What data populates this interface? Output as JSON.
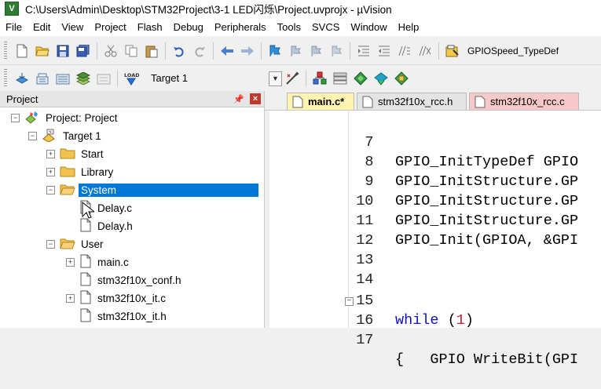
{
  "window": {
    "title": "C:\\Users\\Admin\\Desktop\\STM32Project\\3-1 LED闪烁\\Project.uvprojx - µVision",
    "app_icon": "V"
  },
  "menu": [
    "File",
    "Edit",
    "View",
    "Project",
    "Flash",
    "Debug",
    "Peripherals",
    "Tools",
    "SVCS",
    "Window",
    "Help"
  ],
  "toolbar": {
    "function_combo": "GPIOSpeed_TypeDef",
    "target_select": "Target 1"
  },
  "project_panel": {
    "title": "Project",
    "pin": "📌",
    "close": "×",
    "tree": [
      {
        "label": "Project: Project",
        "level": 0,
        "toggle": "−",
        "icon": "project-root-icon"
      },
      {
        "label": "Target 1",
        "level": 1,
        "toggle": "−",
        "icon": "target-icon"
      },
      {
        "label": "Start",
        "level": 2,
        "toggle": "+",
        "icon": "folder-icon"
      },
      {
        "label": "Library",
        "level": 2,
        "toggle": "+",
        "icon": "folder-icon"
      },
      {
        "label": "System",
        "level": 2,
        "toggle": "−",
        "icon": "folder-open-icon",
        "selected": true
      },
      {
        "label": "Delay.c",
        "level": 3,
        "toggle": "",
        "icon": "file-icon"
      },
      {
        "label": "Delay.h",
        "level": 3,
        "toggle": "",
        "icon": "file-icon"
      },
      {
        "label": "User",
        "level": 2,
        "toggle": "−",
        "icon": "folder-open-icon"
      },
      {
        "label": "main.c",
        "level": 3,
        "toggle": "+",
        "icon": "file-icon"
      },
      {
        "label": "stm32f10x_conf.h",
        "level": 3,
        "toggle": "",
        "icon": "file-icon"
      },
      {
        "label": "stm32f10x_it.c",
        "level": 3,
        "toggle": "+",
        "icon": "file-icon"
      },
      {
        "label": "stm32f10x_it.h",
        "level": 3,
        "toggle": "",
        "icon": "file-icon"
      }
    ]
  },
  "tabs": [
    {
      "label": "main.c*",
      "active": true,
      "color": "#fff3b0"
    },
    {
      "label": "stm32f10x_rcc.h",
      "active": false,
      "color": "#e4e4e4"
    },
    {
      "label": "stm32f10x_rcc.c",
      "active": false,
      "color": "#f7c8c8"
    }
  ],
  "editor": {
    "lines": [
      {
        "n": "7",
        "text": "GPIO_InitTypeDef GPIO",
        "fold": ""
      },
      {
        "n": "8",
        "text": "GPIO_InitStructure.GP",
        "fold": ""
      },
      {
        "n": "9",
        "text": "GPIO_InitStructure.GP",
        "fold": ""
      },
      {
        "n": "10",
        "text": "GPIO_InitStructure.GP",
        "fold": ""
      },
      {
        "n": "11",
        "text": "GPIO_Init(GPIOA, &GPI",
        "fold": ""
      },
      {
        "n": "12",
        "text": "",
        "fold": ""
      },
      {
        "n": "13",
        "text": "",
        "fold": ""
      },
      {
        "n": "14",
        "text": "",
        "fold": ""
      },
      {
        "n": "15",
        "text": "while (1)",
        "fold": ""
      },
      {
        "n": "16",
        "text": "{",
        "fold": "−"
      },
      {
        "n": "17",
        "text": "    GPIO WriteBit(GPI",
        "fold": ""
      }
    ]
  },
  "colors": {
    "accent": "#0078d7",
    "keyword": "#1010c0",
    "number": "#b02030"
  }
}
